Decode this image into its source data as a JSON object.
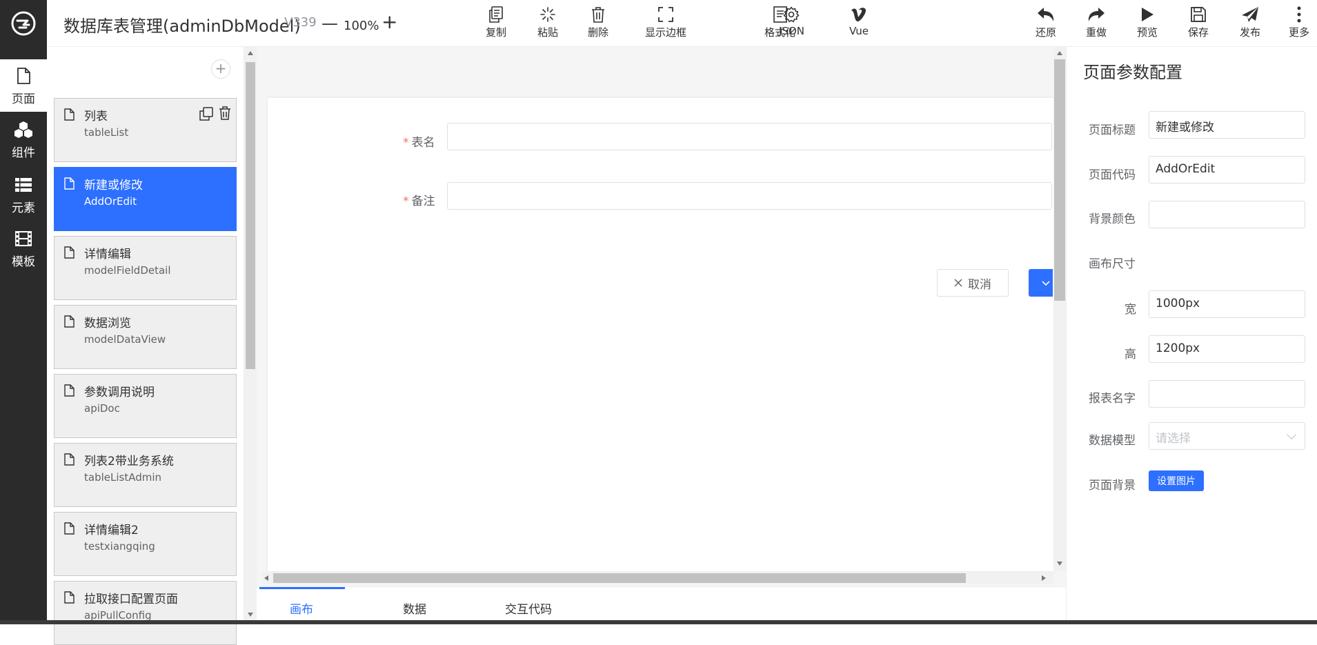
{
  "rail": {
    "items": [
      {
        "label": "页面",
        "icon": "file-icon",
        "active": true
      },
      {
        "label": "组件",
        "icon": "cubes-icon",
        "active": false
      },
      {
        "label": "元素",
        "icon": "list-icon",
        "active": false
      },
      {
        "label": "模板",
        "icon": "film-icon",
        "active": false
      }
    ]
  },
  "header": {
    "title": "数据库表管理(adminDbModel)",
    "version": "V339",
    "zoom": "100%",
    "zoom_minus": "—",
    "zoom_plus": "+",
    "tools": [
      {
        "label": "复制",
        "icon": "copy-icon"
      },
      {
        "label": "粘贴",
        "icon": "paste-icon"
      },
      {
        "label": "删除",
        "icon": "trash-icon"
      },
      {
        "label": "显示边框",
        "icon": "border-icon"
      },
      {
        "label": "格式化",
        "icon": "format-icon"
      },
      {
        "label": "JSON",
        "icon": "gear-icon"
      },
      {
        "label": "Vue",
        "icon": "vue-icon"
      }
    ],
    "actions": [
      {
        "label": "还原",
        "icon": "undo-icon"
      },
      {
        "label": "重做",
        "icon": "redo-icon"
      },
      {
        "label": "预览",
        "icon": "play-icon"
      },
      {
        "label": "保存",
        "icon": "save-icon"
      },
      {
        "label": "发布",
        "icon": "send-icon"
      },
      {
        "label": "更多",
        "icon": "more-icon"
      }
    ]
  },
  "pages": [
    {
      "name": "列表",
      "code": "tableList",
      "active": false
    },
    {
      "name": "新建或修改",
      "code": "AddOrEdit",
      "active": true
    },
    {
      "name": "详情编辑",
      "code": "modelFieldDetail",
      "active": false
    },
    {
      "name": "数据浏览",
      "code": "modelDataView",
      "active": false
    },
    {
      "name": "参数调用说明",
      "code": "apiDoc",
      "active": false
    },
    {
      "name": "列表2带业务系统",
      "code": "tableListAdmin",
      "active": false
    },
    {
      "name": "详情编辑2",
      "code": "testxiangqing",
      "active": false
    },
    {
      "name": "拉取接口配置页面",
      "code": "apiPullConfig",
      "active": false
    }
  ],
  "canvas": {
    "fields": [
      {
        "label": "表名",
        "required": true,
        "value": ""
      },
      {
        "label": "备注",
        "required": true,
        "value": ""
      }
    ],
    "cancel_label": "取消",
    "cancel_icon": "close-icon",
    "confirm_icon": "check-icon"
  },
  "tabs": [
    {
      "label": "画布",
      "active": true
    },
    {
      "label": "数据",
      "active": false
    },
    {
      "label": "交互代码",
      "active": false
    }
  ],
  "props": {
    "title": "页面参数配置",
    "page_title_label": "页面标题",
    "page_title_value": "新建或修改",
    "page_code_label": "页面代码",
    "page_code_value": "AddOrEdit",
    "bg_color_label": "背景颜色",
    "bg_color_value": "",
    "canvas_size_label": "画布尺寸",
    "width_label": "宽",
    "width_value": "1000px",
    "height_label": "高",
    "height_value": "1200px",
    "report_name_label": "报表名字",
    "report_name_value": "",
    "data_model_label": "数据模型",
    "data_model_placeholder": "请选择",
    "page_bg_label": "页面背景",
    "set_image_label": "设置图片"
  },
  "colors": {
    "accent": "#2d6fff",
    "rail_bg": "#2b2b2b",
    "required": "#f56c6c"
  }
}
